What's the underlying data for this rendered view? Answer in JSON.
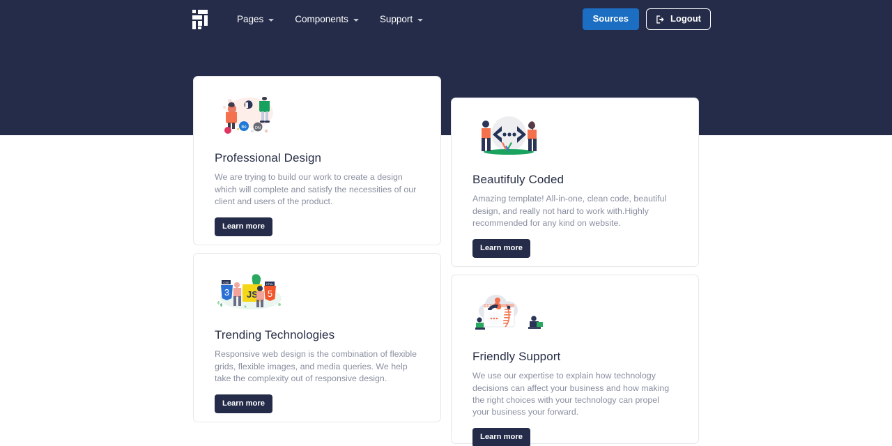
{
  "nav": {
    "logo_name": "grid-logo",
    "links": [
      {
        "label": "Pages",
        "icon": "chevron-down-icon"
      },
      {
        "label": "Components",
        "icon": "chevron-down-icon"
      },
      {
        "label": "Support",
        "icon": "chevron-down-icon"
      }
    ],
    "sources_label": "Sources",
    "logout_label": "Logout",
    "logout_icon": "sign-out-icon"
  },
  "colors": {
    "header_bg": "#252c49",
    "sources_bg": "#1b6ec2",
    "learn_more_bg": "#252c49",
    "page_bg": "#ffffff",
    "card_border": "#e7e7ea",
    "title_text": "#272e45",
    "body_text": "#8a8fa0"
  },
  "cards": [
    {
      "id": "professional-design",
      "illustration": "design-team-illustration",
      "title": "Professional Design",
      "body": "We are trying to build our work to create a design which will complete and satisfy the necessities of our client and users of the product.",
      "button_label": "Learn more"
    },
    {
      "id": "beautifuly-coded",
      "illustration": "code-brackets-illustration",
      "title": "Beautifuly Coded",
      "body": "Amazing template! All-in-one, clean code, beautiful design, and really not hard to work with.Highly recommended for any kind on website.",
      "button_label": "Learn more"
    },
    {
      "id": "trending-technologies",
      "illustration": "web-technologies-illustration",
      "title": "Trending Technologies",
      "body": "Responsive web design is the combination of flexible grids, flexible images, and media queries. We help take the complexity out of responsive design.",
      "button_label": "Learn more"
    },
    {
      "id": "friendly-support",
      "illustration": "support-chat-illustration",
      "title": "Friendly Support",
      "body": "We use our expertise to explain how technology decisions can affect your business and how making the right choices with your technology can propel your business your forward.",
      "button_label": "Learn more"
    }
  ]
}
